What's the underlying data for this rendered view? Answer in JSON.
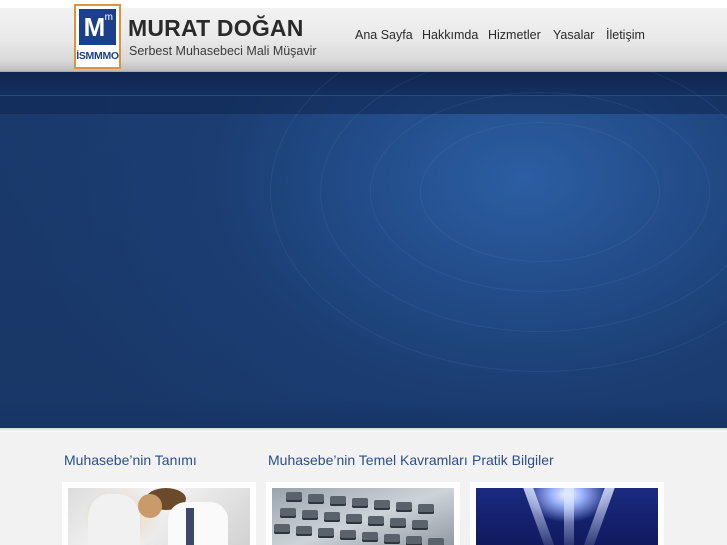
{
  "header": {
    "logo_mark": "M",
    "logo_mark_sup": "m",
    "logo_text": "İSMMMO",
    "brand_name": "MURAT DOĞAN",
    "tagline": "Serbest Muhasebeci Mali Müşavir"
  },
  "nav": {
    "items": [
      {
        "label": "Ana Sayfa"
      },
      {
        "label": "Hakkımda"
      },
      {
        "label": "Hizmetler"
      },
      {
        "label": "Yasalar"
      },
      {
        "label": "İletişim"
      }
    ]
  },
  "sections": [
    {
      "title": "Muhasebe’nin Tanımı",
      "image": "office-people-photo"
    },
    {
      "title": "Muhasebe’nin Temel Kavramları",
      "image": "calculator-keys-photo"
    },
    {
      "title": "Pratik Bilgiler",
      "image": "light-rays-photo"
    }
  ],
  "colors": {
    "logo_blue": "#1b3f8b",
    "logo_border": "#e0913a",
    "hero_blue": "#1a3a6d",
    "section_title": "#2b4f8a"
  }
}
